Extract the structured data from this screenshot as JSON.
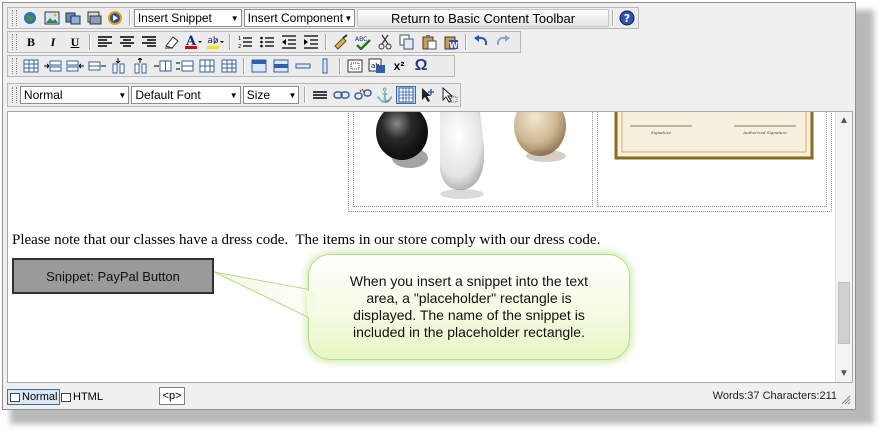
{
  "toolbar1": {
    "insert_snippet": "Insert Snippet",
    "insert_component": "Insert Component",
    "return_basic": "Return to Basic Content Toolbar"
  },
  "toolbar4": {
    "paragraph_format": "Normal",
    "font": "Default Font",
    "size": "Size"
  },
  "editor": {
    "paragraph": "Please note that our classes have a dress code.  The items in our store comply with our dress code.",
    "snippet_placeholder": "Snippet: PayPal Button",
    "certificate_sig_left": "Signature",
    "certificate_sig_right": "Authorized Signature"
  },
  "callout": {
    "text": "When you insert a snippet into the text area, a \"placeholder\" rectangle is displayed. The name of the snippet is included in the placeholder rectangle."
  },
  "statusbar": {
    "normal_tab": "Normal",
    "html_tab": "HTML",
    "tag": "<p>",
    "counts": "Words:37 Characters:211"
  },
  "icons": {
    "bold": "B",
    "italic": "I",
    "underline": "U",
    "superscript": "x²",
    "omega": "Ω",
    "anchor": "⚓"
  },
  "colors": {
    "callout_border": "#b7d98a",
    "snippet_fill": "#9a9a9a",
    "certificate_frame": "#8b6a1e"
  }
}
